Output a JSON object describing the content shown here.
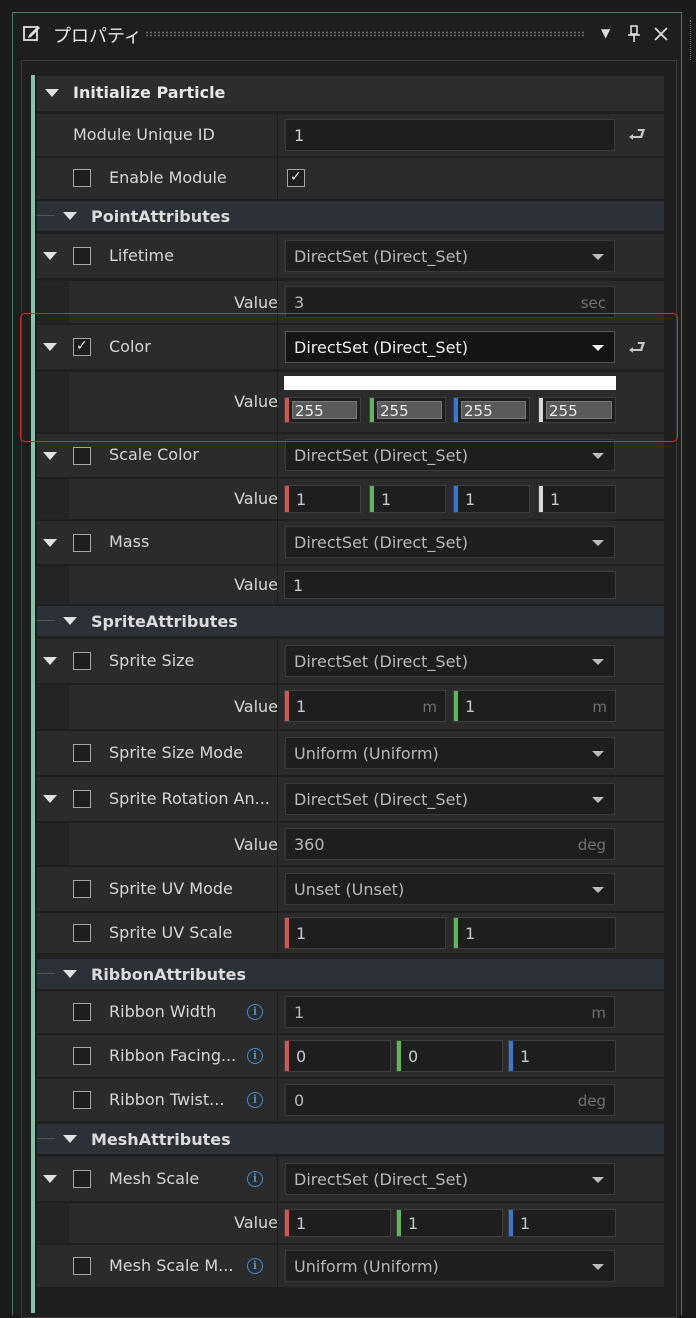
{
  "window": {
    "title": "プロパティ",
    "pin_icon": "pin-icon",
    "close_icon": "close-icon",
    "dropdown_icon": "chevron-down-icon"
  },
  "colors": {
    "accent": "#86c4a9",
    "highlight": "#d62b2b",
    "red": "#d9534f",
    "green": "#5cb85c",
    "blue": "#3a78d6",
    "white": "#d8d8d8",
    "info": "#3d8fd6"
  },
  "panel": {
    "header": "Initialize Particle",
    "module_unique_id": {
      "label": "Module Unique ID",
      "value": "1"
    },
    "enable_module": {
      "label": "Enable Module",
      "checked": true
    }
  },
  "sections": {
    "point": "PointAttributes",
    "sprite": "SpriteAttributes",
    "ribbon": "RibbonAttributes",
    "mesh": "MeshAttributes"
  },
  "value_label": "Value",
  "props": {
    "lifetime": {
      "label": "Lifetime",
      "mode": "DirectSet  (Direct_Set)",
      "value": "3",
      "unit": "sec"
    },
    "color": {
      "label": "Color",
      "mode": "DirectSet  (Direct_Set)",
      "r": "255",
      "g": "255",
      "b": "255",
      "a": "255"
    },
    "scale_color": {
      "label": "Scale Color",
      "mode": "DirectSet  (Direct_Set)",
      "r": "1",
      "g": "1",
      "b": "1",
      "a": "1"
    },
    "mass": {
      "label": "Mass",
      "mode": "DirectSet  (Direct_Set)",
      "value": "1"
    },
    "sprite_size": {
      "label": "Sprite Size",
      "mode": "DirectSet  (Direct_Set)",
      "x": "1",
      "y": "1",
      "unit": "m"
    },
    "sprite_size_mode": {
      "label": "Sprite Size Mode",
      "mode": "Uniform  (Uniform)"
    },
    "sprite_rotation": {
      "label": "Sprite Rotation An...",
      "mode": "DirectSet  (Direct_Set)",
      "value": "360",
      "unit": "deg"
    },
    "sprite_uv_mode": {
      "label": "Sprite UV Mode",
      "mode": "Unset  (Unset)"
    },
    "sprite_uv_scale": {
      "label": "Sprite UV Scale",
      "x": "1",
      "y": "1"
    },
    "ribbon_width": {
      "label": "Ribbon Width",
      "value": "1",
      "unit": "m"
    },
    "ribbon_facing": {
      "label": "Ribbon Facing...",
      "x": "0",
      "y": "0",
      "z": "1"
    },
    "ribbon_twist": {
      "label": "Ribbon Twist...",
      "value": "0",
      "unit": "deg"
    },
    "mesh_scale": {
      "label": "Mesh Scale",
      "mode": "DirectSet  (Direct_Set)",
      "x": "1",
      "y": "1",
      "z": "1"
    },
    "mesh_scale_mode": {
      "label": "Mesh Scale M...",
      "mode": "Uniform  (Uniform)"
    }
  }
}
